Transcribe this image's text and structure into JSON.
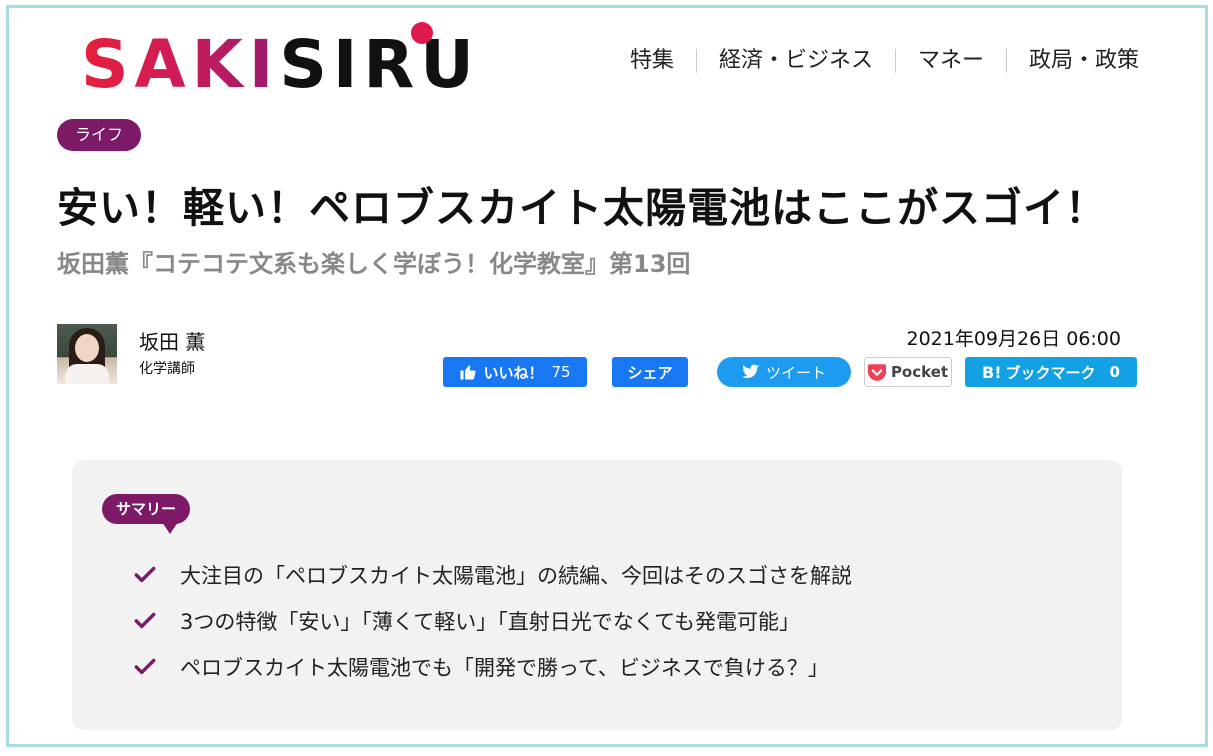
{
  "header": {
    "logo_part1": "SAKI",
    "logo_part2": "SIRU",
    "nav": [
      "特集",
      "経済・ビジネス",
      "マネー",
      "政局・政策"
    ]
  },
  "article": {
    "category": "ライフ",
    "title": "安い！軽い！ペロブスカイト太陽電池はここがスゴイ！",
    "subtitle": "坂田薫『コテコテ文系も楽しく学ぼう！化学教室』第13回",
    "author": {
      "name": "坂田 薫",
      "role": "化学講師"
    },
    "date": "2021年09月26日 06:00"
  },
  "share": {
    "like_label": "いいね！",
    "like_count": "75",
    "share_label": "シェア",
    "tweet_label": "ツイート",
    "pocket_label": "Pocket",
    "hatena_label": "ブックマーク",
    "hatena_count": "0"
  },
  "summary": {
    "badge": "サマリー",
    "items": [
      "大注目の「ペロブスカイト太陽電池」の続編、今回はそのスゴさを解説",
      "3つの特徴「安い」「薄くて軽い」「直射日光でなくても発電可能」",
      "ペロブスカイト太陽電池でも「開発で勝って、ビジネスで負ける？」"
    ]
  },
  "colors": {
    "accent": "#7c1a68",
    "facebook": "#1877f2",
    "twitter": "#1d9bf0",
    "hatena": "#13a1e5",
    "border": "#a9dde3"
  }
}
